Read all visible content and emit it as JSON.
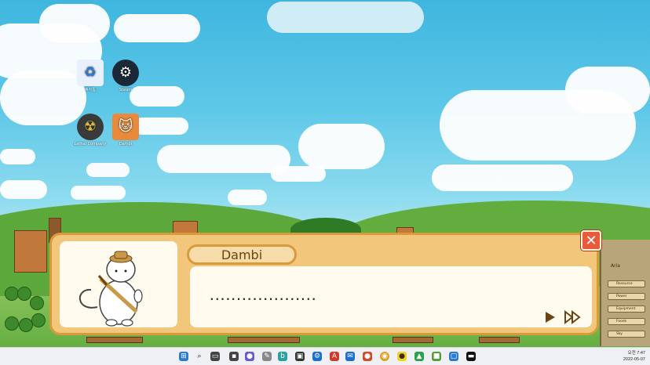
{
  "desktop": {
    "icons": [
      {
        "label": "휴지통",
        "icon": "recycle-bin-icon"
      },
      {
        "label": "Steam",
        "icon": "steam-icon"
      },
      {
        "label": "Lethal Company",
        "icon": "lethal-company-icon"
      },
      {
        "label": "Dambi",
        "icon": "dambi-game-icon"
      }
    ]
  },
  "dialog": {
    "speaker": "Dambi",
    "text": "....................",
    "portrait": "white-cat-with-hat-portrait",
    "play_icon": "play-icon",
    "fast_forward_icon": "fast-forward-icon",
    "close_icon": "close-icon"
  },
  "side_panel": {
    "title": "Aria",
    "buttons": [
      "Resource",
      "Power",
      "Equipment",
      "Foods",
      "Sky"
    ]
  },
  "taskbar": {
    "icons": [
      "windows-start-icon",
      "search-icon",
      "task-view-icon",
      "file-explorer-icon",
      "chat-icon",
      "edit-icon",
      "bing-icon",
      "store-icon",
      "settings-icon",
      "adobe-icon",
      "mail-icon",
      "game-icon",
      "chrome-icon",
      "kakao-icon",
      "photos-icon",
      "app-icon",
      "app-icon",
      "terminal-icon"
    ],
    "clock_time": "오전 7:47",
    "clock_date": "2022-05-07"
  },
  "colors": {
    "dialog_bg": "#f2c77c",
    "dialog_border": "#d99a3c",
    "close_button": "#e85a3a",
    "speaker_text": "#6a4412"
  }
}
